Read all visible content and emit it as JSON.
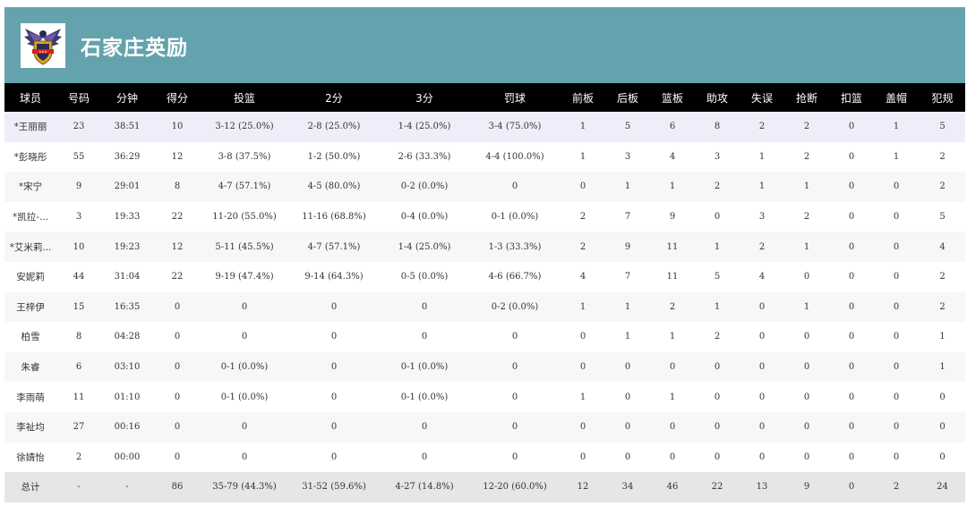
{
  "team": {
    "name": "石家庄英励",
    "logo_icon": "team-crest-icon",
    "header_color": "#64a3ad"
  },
  "columns": [
    "球员",
    "号码",
    "分钟",
    "得分",
    "投篮",
    "2分",
    "3分",
    "罚球",
    "前板",
    "后板",
    "篮板",
    "助攻",
    "失误",
    "抢断",
    "扣篮",
    "盖帽",
    "犯规"
  ],
  "players": [
    [
      "*王丽丽",
      "23",
      "38:51",
      "10",
      "3-12 (25.0%)",
      "2-8 (25.0%)",
      "1-4 (25.0%)",
      "3-4 (75.0%)",
      "1",
      "5",
      "6",
      "8",
      "2",
      "2",
      "0",
      "1",
      "5"
    ],
    [
      "*彭晓彤",
      "55",
      "36:29",
      "12",
      "3-8 (37.5%)",
      "1-2 (50.0%)",
      "2-6 (33.3%)",
      "4-4 (100.0%)",
      "1",
      "3",
      "4",
      "3",
      "1",
      "2",
      "0",
      "1",
      "2"
    ],
    [
      "*宋宁",
      "9",
      "29:01",
      "8",
      "4-7 (57.1%)",
      "4-5 (80.0%)",
      "0-2 (0.0%)",
      "0",
      "0",
      "1",
      "1",
      "2",
      "1",
      "1",
      "0",
      "0",
      "2"
    ],
    [
      "*凯拉-...",
      "3",
      "19:33",
      "22",
      "11-20 (55.0%)",
      "11-16 (68.8%)",
      "0-4 (0.0%)",
      "0-1 (0.0%)",
      "2",
      "7",
      "9",
      "0",
      "3",
      "2",
      "0",
      "0",
      "5"
    ],
    [
      "*艾米莉...",
      "10",
      "19:23",
      "12",
      "5-11 (45.5%)",
      "4-7 (57.1%)",
      "1-4 (25.0%)",
      "1-3 (33.3%)",
      "2",
      "9",
      "11",
      "1",
      "2",
      "1",
      "0",
      "0",
      "4"
    ],
    [
      "安妮莉",
      "44",
      "31:04",
      "22",
      "9-19 (47.4%)",
      "9-14 (64.3%)",
      "0-5 (0.0%)",
      "4-6 (66.7%)",
      "4",
      "7",
      "11",
      "5",
      "4",
      "0",
      "0",
      "0",
      "2"
    ],
    [
      "王梓伊",
      "15",
      "16:35",
      "0",
      "0",
      "0",
      "0",
      "0-2 (0.0%)",
      "1",
      "1",
      "2",
      "1",
      "0",
      "1",
      "0",
      "0",
      "2"
    ],
    [
      "柏雪",
      "8",
      "04:28",
      "0",
      "0",
      "0",
      "0",
      "0",
      "0",
      "1",
      "1",
      "2",
      "0",
      "0",
      "0",
      "0",
      "1"
    ],
    [
      "朱睿",
      "6",
      "03:10",
      "0",
      "0-1 (0.0%)",
      "0",
      "0-1 (0.0%)",
      "0",
      "0",
      "0",
      "0",
      "0",
      "0",
      "0",
      "0",
      "0",
      "1"
    ],
    [
      "李雨萌",
      "11",
      "01:10",
      "0",
      "0-1 (0.0%)",
      "0",
      "0-1 (0.0%)",
      "0",
      "1",
      "0",
      "1",
      "0",
      "0",
      "0",
      "0",
      "0",
      "0"
    ],
    [
      "李祉均",
      "27",
      "00:16",
      "0",
      "0",
      "0",
      "0",
      "0",
      "0",
      "0",
      "0",
      "0",
      "0",
      "0",
      "0",
      "0",
      "0"
    ],
    [
      "徐婧怡",
      "2",
      "00:00",
      "0",
      "0",
      "0",
      "0",
      "0",
      "0",
      "0",
      "0",
      "0",
      "0",
      "0",
      "0",
      "0",
      "0"
    ]
  ],
  "totals": [
    "总计",
    "-",
    "-",
    "86",
    "35-79 (44.3%)",
    "31-52 (59.6%)",
    "4-27 (14.8%)",
    "12-20 (60.0%)",
    "12",
    "34",
    "46",
    "22",
    "13",
    "9",
    "0",
    "2",
    "24"
  ]
}
